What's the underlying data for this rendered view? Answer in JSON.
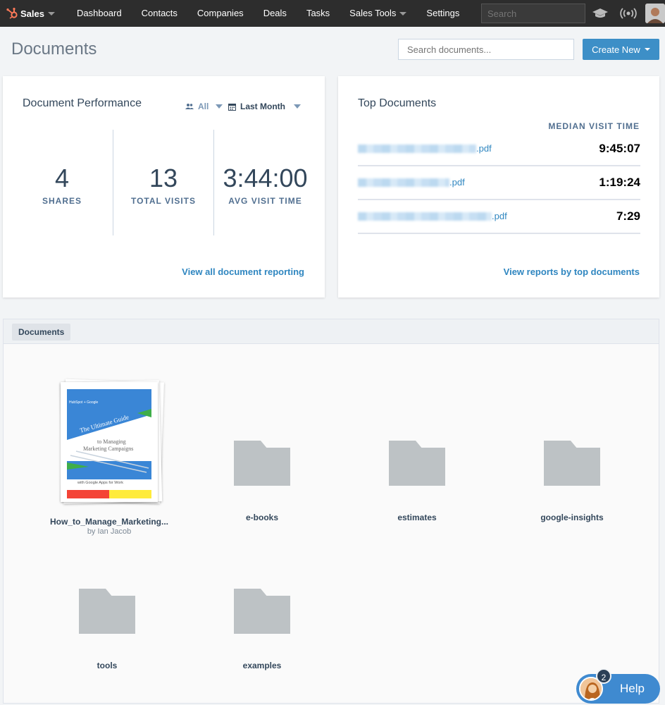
{
  "nav": {
    "brand": "Sales",
    "items": [
      "Dashboard",
      "Contacts",
      "Companies",
      "Deals",
      "Tasks",
      "Sales Tools",
      "Settings"
    ],
    "search_placeholder": "Search",
    "icons": [
      "graduation-cap-icon",
      "broadcast-icon",
      "avatar"
    ]
  },
  "header": {
    "title": "Documents",
    "search_placeholder": "Search documents...",
    "create_label": "Create New"
  },
  "performance": {
    "title": "Document Performance",
    "filter_owner": "All",
    "filter_range": "Last Month",
    "stats": [
      {
        "value": "4",
        "label": "SHARES"
      },
      {
        "value": "13",
        "label": "TOTAL VISITS"
      },
      {
        "value": "3:44:00",
        "label": "AVG VISIT TIME"
      }
    ],
    "link": "View all document reporting"
  },
  "top_documents": {
    "title": "Top Documents",
    "column_header": "MEDIAN VISIT TIME",
    "rows": [
      {
        "suffix": ".pdf",
        "time": "9:45:07"
      },
      {
        "suffix": ".pdf",
        "time": "1:19:24"
      },
      {
        "suffix": ".pdf",
        "time": "7:29"
      }
    ],
    "link": "View reports by top documents"
  },
  "documents": {
    "tab": "Documents",
    "items": [
      {
        "name": "How_to_Manage_Marketing...",
        "author": "by Ian Jacob",
        "kind": "file"
      },
      {
        "name": "e-books",
        "kind": "folder"
      },
      {
        "name": "estimates",
        "kind": "folder"
      },
      {
        "name": "google-insights",
        "kind": "folder"
      },
      {
        "name": "tools",
        "kind": "folder"
      },
      {
        "name": "examples",
        "kind": "folder"
      }
    ],
    "thumb": {
      "brand_line": "HubSpot + Google",
      "title_1": "The Ultimate Guide",
      "title_2": "to Managing",
      "title_3": "Marketing Campaigns",
      "footer": "with Google Apps for Work"
    }
  },
  "help": {
    "label": "Help",
    "badge": "2"
  },
  "colors": {
    "nav_bg": "#2d2d2d",
    "accent": "#3d8fc7",
    "link": "#2f86c0",
    "folder": "#bdc2c5",
    "brand_orange": "#ff7a59"
  }
}
